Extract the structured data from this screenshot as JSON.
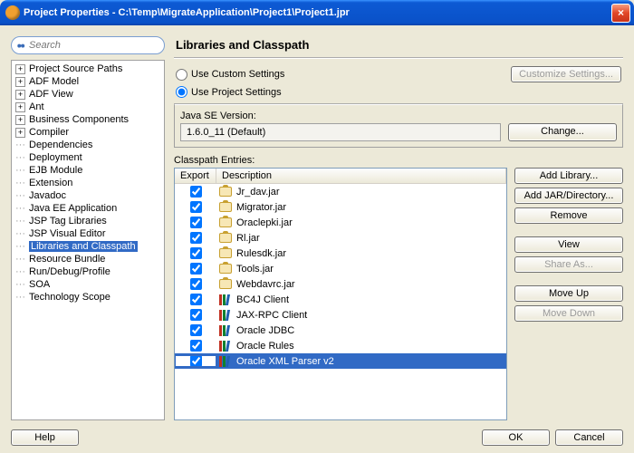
{
  "window": {
    "title": "Project Properties - C:\\Temp\\MigrateApplication\\Project1\\Project1.jpr"
  },
  "search": {
    "placeholder": "Search"
  },
  "tree": {
    "items": [
      {
        "label": "Project Source Paths",
        "exp": true
      },
      {
        "label": "ADF Model",
        "exp": true
      },
      {
        "label": "ADF View",
        "exp": true
      },
      {
        "label": "Ant",
        "exp": true
      },
      {
        "label": "Business Components",
        "exp": true
      },
      {
        "label": "Compiler",
        "exp": true
      },
      {
        "label": "Dependencies",
        "exp": false
      },
      {
        "label": "Deployment",
        "exp": false
      },
      {
        "label": "EJB Module",
        "exp": false
      },
      {
        "label": "Extension",
        "exp": false
      },
      {
        "label": "Javadoc",
        "exp": false
      },
      {
        "label": "Java EE Application",
        "exp": false
      },
      {
        "label": "JSP Tag Libraries",
        "exp": false
      },
      {
        "label": "JSP Visual Editor",
        "exp": false
      },
      {
        "label": "Libraries and Classpath",
        "exp": false,
        "selected": true
      },
      {
        "label": "Resource Bundle",
        "exp": false
      },
      {
        "label": "Run/Debug/Profile",
        "exp": false
      },
      {
        "label": "SOA",
        "exp": false
      },
      {
        "label": "Technology Scope",
        "exp": false
      }
    ]
  },
  "panel": {
    "title": "Libraries and Classpath",
    "useCustom": "Use Custom Settings",
    "useProject": "Use Project Settings",
    "customize": "Customize Settings...",
    "javaLabel": "Java SE Version:",
    "javaValue": "1.6.0_11 (Default)",
    "change": "Change...",
    "classpathLabel": "Classpath Entries:",
    "cols": {
      "export": "Export",
      "desc": "Description"
    },
    "entries": [
      {
        "desc": "Jr_dav.jar",
        "kind": "jar"
      },
      {
        "desc": "Migrator.jar",
        "kind": "jar"
      },
      {
        "desc": "Oraclepki.jar",
        "kind": "jar"
      },
      {
        "desc": "Rl.jar",
        "kind": "jar"
      },
      {
        "desc": "Rulesdk.jar",
        "kind": "jar"
      },
      {
        "desc": "Tools.jar",
        "kind": "jar"
      },
      {
        "desc": "Webdavrc.jar",
        "kind": "jar"
      },
      {
        "desc": "BC4J Client",
        "kind": "lib"
      },
      {
        "desc": "JAX-RPC Client",
        "kind": "lib"
      },
      {
        "desc": "Oracle JDBC",
        "kind": "lib"
      },
      {
        "desc": "Oracle Rules",
        "kind": "lib"
      },
      {
        "desc": "Oracle XML Parser v2",
        "kind": "lib",
        "selected": true
      }
    ],
    "buttons": {
      "addLib": "Add Library...",
      "addJar": "Add JAR/Directory...",
      "remove": "Remove",
      "view": "View",
      "share": "Share As...",
      "moveUp": "Move Up",
      "moveDown": "Move Down"
    }
  },
  "footer": {
    "help": "Help",
    "ok": "OK",
    "cancel": "Cancel"
  }
}
